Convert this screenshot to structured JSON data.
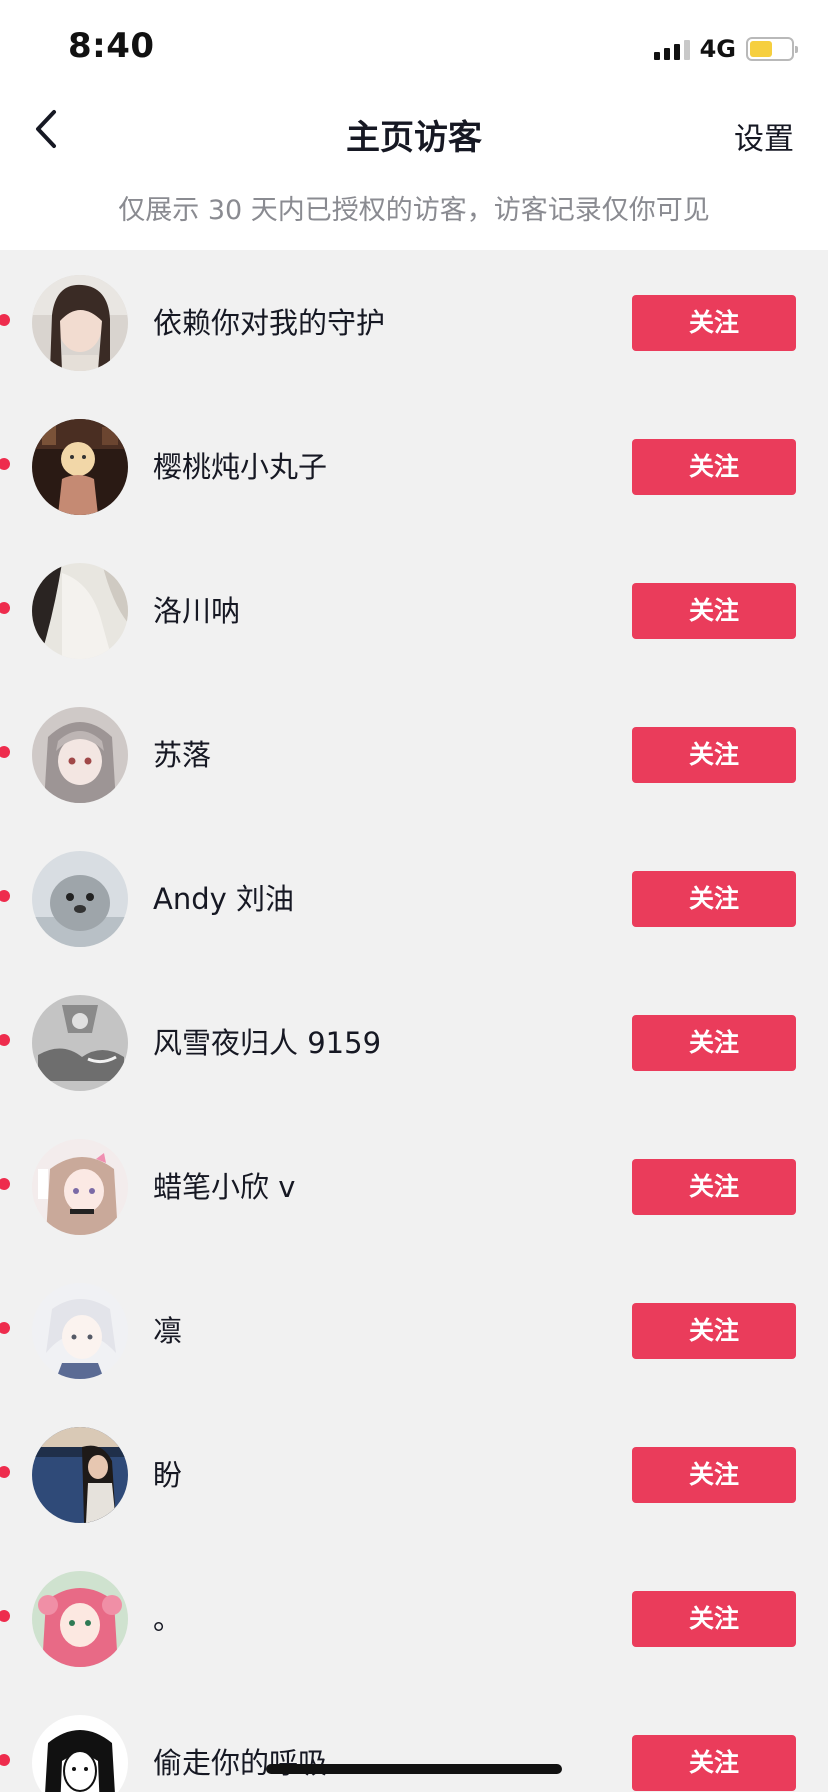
{
  "status_bar": {
    "time": "8:40",
    "network": "4G"
  },
  "nav": {
    "title": "主页访客",
    "settings_label": "设置"
  },
  "notice": "仅展示 30 天内已授权的访客，访客记录仅你可见",
  "visitors": [
    {
      "name": "依赖你对我的守护",
      "follow_label": "关注",
      "avatar_icon": "avatar-photo-woman"
    },
    {
      "name": "樱桃炖小丸子",
      "follow_label": "关注",
      "avatar_icon": "avatar-photo-dark"
    },
    {
      "name": "洛川呐",
      "follow_label": "关注",
      "avatar_icon": "avatar-photo-light"
    },
    {
      "name": "苏落",
      "follow_label": "关注",
      "avatar_icon": "avatar-anime-gray"
    },
    {
      "name": "Andy 刘油",
      "follow_label": "关注",
      "avatar_icon": "avatar-seal"
    },
    {
      "name": "风雪夜归人 9159",
      "follow_label": "关注",
      "avatar_icon": "avatar-sketch-bw"
    },
    {
      "name": "蜡笔小欣 v",
      "follow_label": "关注",
      "avatar_icon": "avatar-anime-pink"
    },
    {
      "name": "凛",
      "follow_label": "关注",
      "avatar_icon": "avatar-anime-white"
    },
    {
      "name": "盼",
      "follow_label": "关注",
      "avatar_icon": "avatar-photo-lake"
    },
    {
      "name": "。",
      "follow_label": "关注",
      "avatar_icon": "avatar-anime-red"
    },
    {
      "name": "偷走你的呼吸",
      "follow_label": "关注",
      "avatar_icon": "avatar-ink-bw"
    }
  ],
  "colors": {
    "follow_button": "#ea3c5b",
    "unread_dot": "#ee2c4d",
    "list_background": "#f1f1f1",
    "header_background": "#ffffff",
    "battery_fill": "#f6cf3f"
  }
}
